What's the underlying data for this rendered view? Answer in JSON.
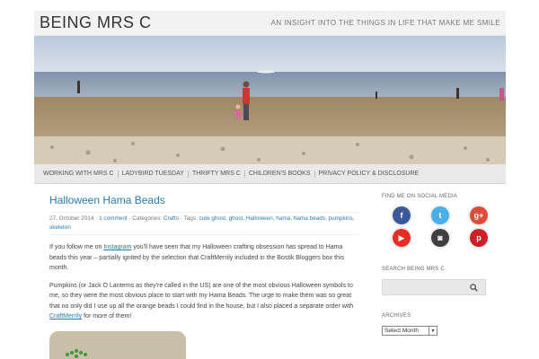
{
  "header": {
    "site_title": "BEING MRS C",
    "tagline": "AN INSIGHT INTO THE THINGS IN LIFE THAT MAKE ME SMILE"
  },
  "nav": {
    "items": [
      "WORKING WITH MRS C",
      "LADYBIRD TUESDAY",
      "THRIFTY MRS C",
      "CHILDREN'S BOOKS",
      "PRIVACY POLICY & DISCLOSURE"
    ]
  },
  "post": {
    "title": "Halloween Hama Beads",
    "meta": {
      "date": "27. October 2014",
      "comments": "1 comment",
      "categories_label": "Categories:",
      "category": "Crafts",
      "tags_label": "Tags:",
      "tags": [
        "cute ghost",
        "ghost",
        "Halloween",
        "hama",
        "hama beads",
        "pumpkins",
        "skeleton"
      ]
    },
    "para1": {
      "before": "If you follow me on ",
      "link": "Instagram",
      "after": " you'll have seen that my Halloween crafting obsession has spread to Hama beads this year – partially ignited by the selection that CraftMerrily included in the Bostik Bloggers box this month."
    },
    "para2": {
      "before": "Pumpkins (or Jack O Lanterns as they're called in the US) are one of the most obvious Halloween symbols to me, so they were the most obvious place to start with my Hama Beads. The urge to make them was so great that no only did I use up all the orange beads I could find in the house, but I also placed a separate order with ",
      "link": "CraftMerrily",
      "after": " for more of them!"
    }
  },
  "sidebar": {
    "social_heading": "FIND ME ON SOCIAL MEDIA",
    "social": [
      {
        "glyph": "f",
        "color": "#3b5998"
      },
      {
        "glyph": "t",
        "color": "#4aaee8"
      },
      {
        "glyph": "g+",
        "color": "#dd4b39"
      },
      {
        "glyph": "▶",
        "color": "#e52d27"
      },
      {
        "glyph": "◙",
        "color": "#3f3f3f"
      },
      {
        "glyph": "p",
        "color": "#cb2027"
      }
    ],
    "search_heading": "SEARCH BEING MRS C",
    "search_placeholder": "",
    "archives_heading": "ARCHIVES",
    "archive_selected": "Select Month"
  }
}
